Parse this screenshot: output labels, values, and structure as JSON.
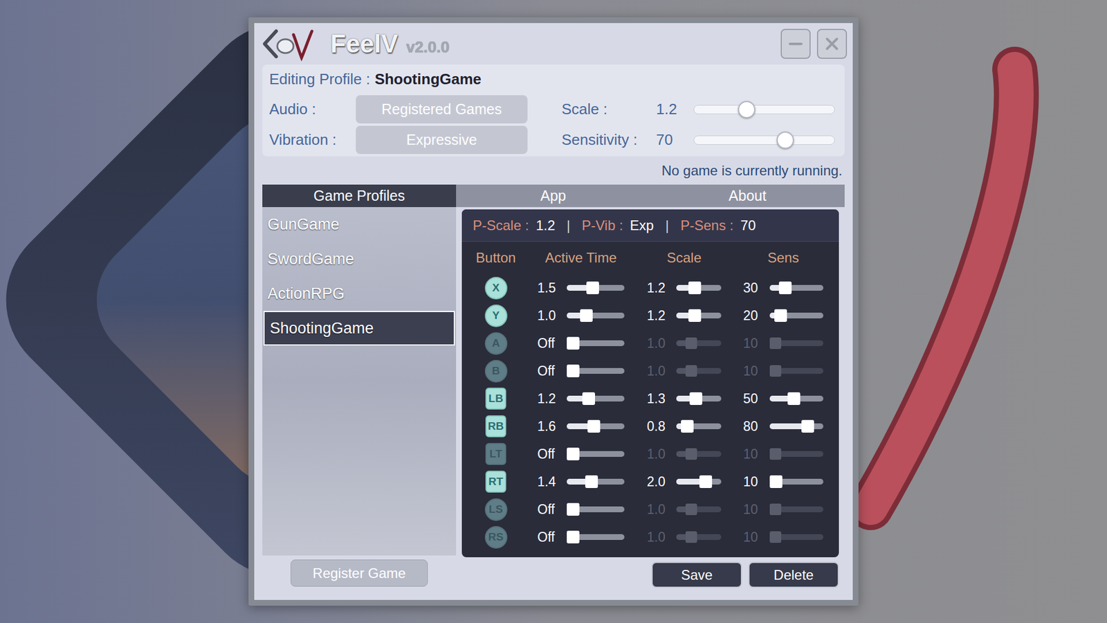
{
  "window": {
    "title": "FeelV",
    "version": "v2.0.0"
  },
  "editing": {
    "label": "Editing Profile :",
    "profile": "ShootingGame"
  },
  "settings": [
    {
      "label": "Audio :",
      "kind": "button",
      "value": "Registered Games"
    },
    {
      "label": "Vibration :",
      "kind": "button",
      "value": "Expressive"
    }
  ],
  "sliders": [
    {
      "label": "Scale :",
      "value": "1.2",
      "level": 0.36
    },
    {
      "label": "Sensitivity :",
      "value": "70",
      "level": 0.67
    }
  ],
  "status": "No game is currently running.",
  "tabs": [
    {
      "label": "Game Profiles",
      "selected": true
    },
    {
      "label": "App",
      "selected": false
    },
    {
      "label": "About",
      "selected": false
    }
  ],
  "profiles": [
    {
      "name": "GunGame",
      "selected": false
    },
    {
      "name": "SwordGame",
      "selected": false
    },
    {
      "name": "ActionRPG",
      "selected": false
    },
    {
      "name": "ShootingGame",
      "selected": true
    }
  ],
  "summary": {
    "items": [
      {
        "label": "P-Scale :",
        "value": "1.2"
      },
      {
        "label": "P-Vib :",
        "value": "Exp"
      },
      {
        "label": "P-Sens :",
        "value": "70"
      }
    ],
    "separator": "|"
  },
  "table": {
    "columns": [
      "Button",
      "Active Time",
      "Scale",
      "Sens"
    ],
    "rows": [
      {
        "button": "X",
        "kind": "round",
        "disabled": false,
        "active_time": "1.5",
        "active_level": 0.43,
        "scale": "1.2",
        "scale_level": 0.37,
        "sens": "30",
        "sens_level": 0.22
      },
      {
        "button": "Y",
        "kind": "round",
        "disabled": false,
        "active_time": "1.0",
        "active_level": 0.29,
        "scale": "1.2",
        "scale_level": 0.37,
        "sens": "20",
        "sens_level": 0.11
      },
      {
        "button": "A",
        "kind": "round",
        "disabled": true,
        "active_time": "Off",
        "active_level": 0,
        "scale": "1.0",
        "scale_level": 0.28,
        "sens": "10",
        "sens_level": 0
      },
      {
        "button": "B",
        "kind": "round",
        "disabled": true,
        "active_time": "Off",
        "active_level": 0,
        "scale": "1.0",
        "scale_level": 0.28,
        "sens": "10",
        "sens_level": 0
      },
      {
        "button": "LB",
        "kind": "square",
        "disabled": false,
        "active_time": "1.2",
        "active_level": 0.35,
        "scale": "1.3",
        "scale_level": 0.41,
        "sens": "50",
        "sens_level": 0.44
      },
      {
        "button": "RB",
        "kind": "square",
        "disabled": false,
        "active_time": "1.6",
        "active_level": 0.46,
        "scale": "0.8",
        "scale_level": 0.15,
        "sens": "80",
        "sens_level": 0.78
      },
      {
        "button": "LT",
        "kind": "square",
        "disabled": true,
        "active_time": "Off",
        "active_level": 0,
        "scale": "1.0",
        "scale_level": 0.28,
        "sens": "10",
        "sens_level": 0
      },
      {
        "button": "RT",
        "kind": "square",
        "disabled": false,
        "active_time": "1.4",
        "active_level": 0.41,
        "scale": "2.0",
        "scale_level": 0.72,
        "sens": "10",
        "sens_level": 0
      },
      {
        "button": "LS",
        "kind": "round",
        "disabled": true,
        "active_time": "Off",
        "active_level": 0,
        "scale": "1.0",
        "scale_level": 0.28,
        "sens": "10",
        "sens_level": 0
      },
      {
        "button": "RS",
        "kind": "round",
        "disabled": true,
        "active_time": "Off",
        "active_level": 0,
        "scale": "1.0",
        "scale_level": 0.28,
        "sens": "10",
        "sens_level": 0
      }
    ]
  },
  "buttons": {
    "register": "Register Game",
    "save": "Save",
    "delete": "Delete"
  }
}
